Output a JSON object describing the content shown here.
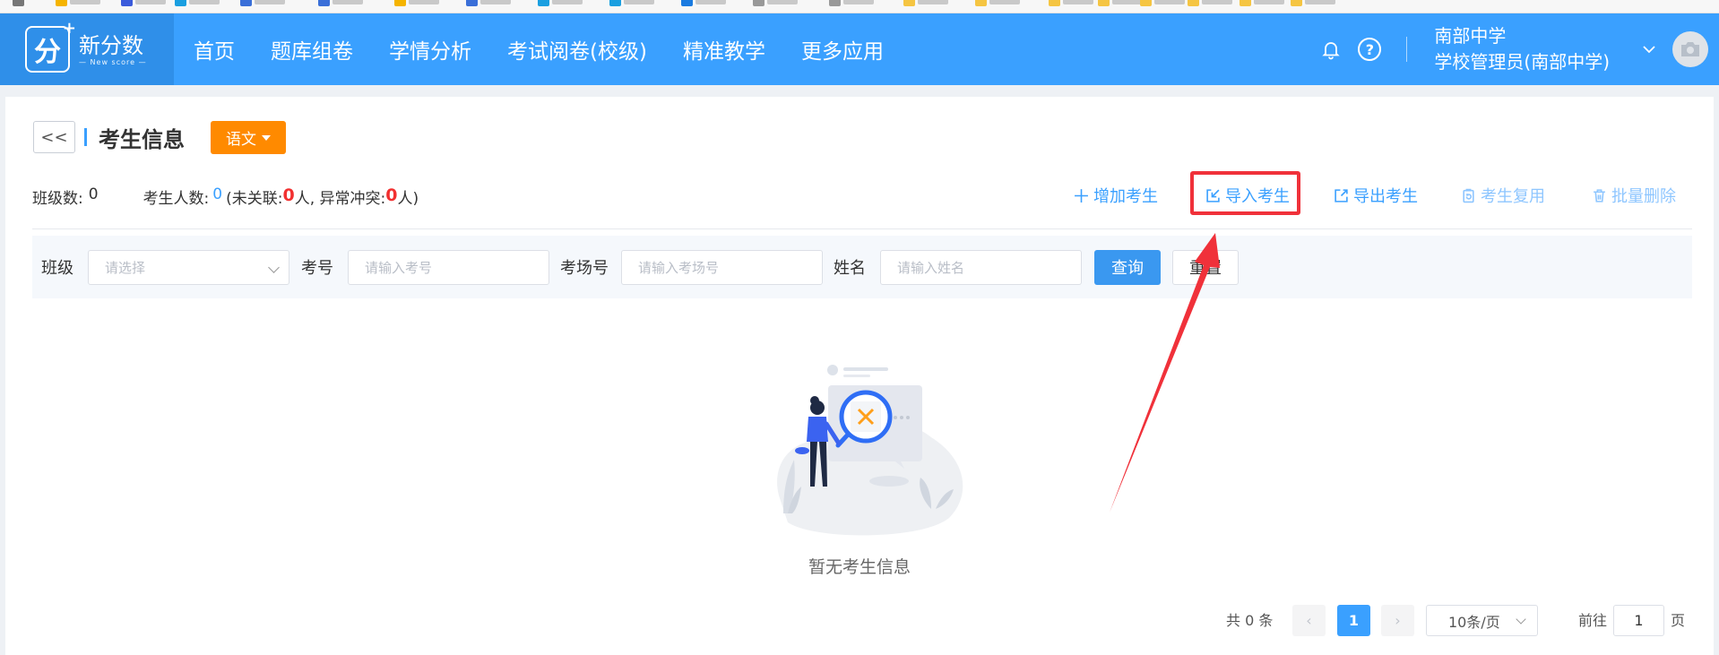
{
  "nav": {
    "logo": {
      "cn": "新分数",
      "en": "— New score —",
      "mark": "分"
    },
    "items": [
      {
        "label": "首页"
      },
      {
        "label": "题库组卷"
      },
      {
        "label": "学情分析"
      },
      {
        "label": "考试阅卷(校级)"
      },
      {
        "label": "精准教学"
      },
      {
        "label": "更多应用"
      }
    ],
    "help_glyph": "?",
    "user": {
      "school": "南部中学",
      "role": "学校管理员(南部中学)"
    }
  },
  "header": {
    "back_label": "<<",
    "title": "考生信息",
    "subject": "语文"
  },
  "stats": {
    "class_label": "班级数:",
    "class_count": "0",
    "student_label": "考生人数:",
    "student_count": "0",
    "unlinked_label": "(未关联:",
    "unlinked_count": "0",
    "conflict_label": "人, 异常冲突:",
    "conflict_count": "0",
    "suffix": "人)"
  },
  "actions": [
    {
      "label": "增加考生",
      "icon": "plus-icon"
    },
    {
      "label": "导入考生",
      "icon": "import-icon"
    },
    {
      "label": "导出考生",
      "icon": "export-icon"
    },
    {
      "label": "考生复用",
      "icon": "reuse-icon"
    },
    {
      "label": "批量删除",
      "icon": "trash-icon"
    }
  ],
  "filters": {
    "class": {
      "label": "班级",
      "placeholder": "请选择"
    },
    "exam_no": {
      "label": "考号",
      "placeholder": "请输入考号"
    },
    "room_no": {
      "label": "考场号",
      "placeholder": "请输入考场号"
    },
    "name": {
      "label": "姓名",
      "placeholder": "请输入姓名"
    },
    "query_label": "查询",
    "reset_label": "重置"
  },
  "empty": {
    "text": "暂无考生信息"
  },
  "pagination": {
    "total": "共 0 条",
    "prev": "‹",
    "current_page": "1",
    "next": "›",
    "page_size": "10条/页",
    "goto_label": "前往",
    "goto_value": "1",
    "page_suffix": "页"
  },
  "colors": {
    "primary": "#3aa0ff",
    "subject_orange": "#ff8a00",
    "annotation_red": "#f0313a",
    "danger_text": "#f23030"
  }
}
